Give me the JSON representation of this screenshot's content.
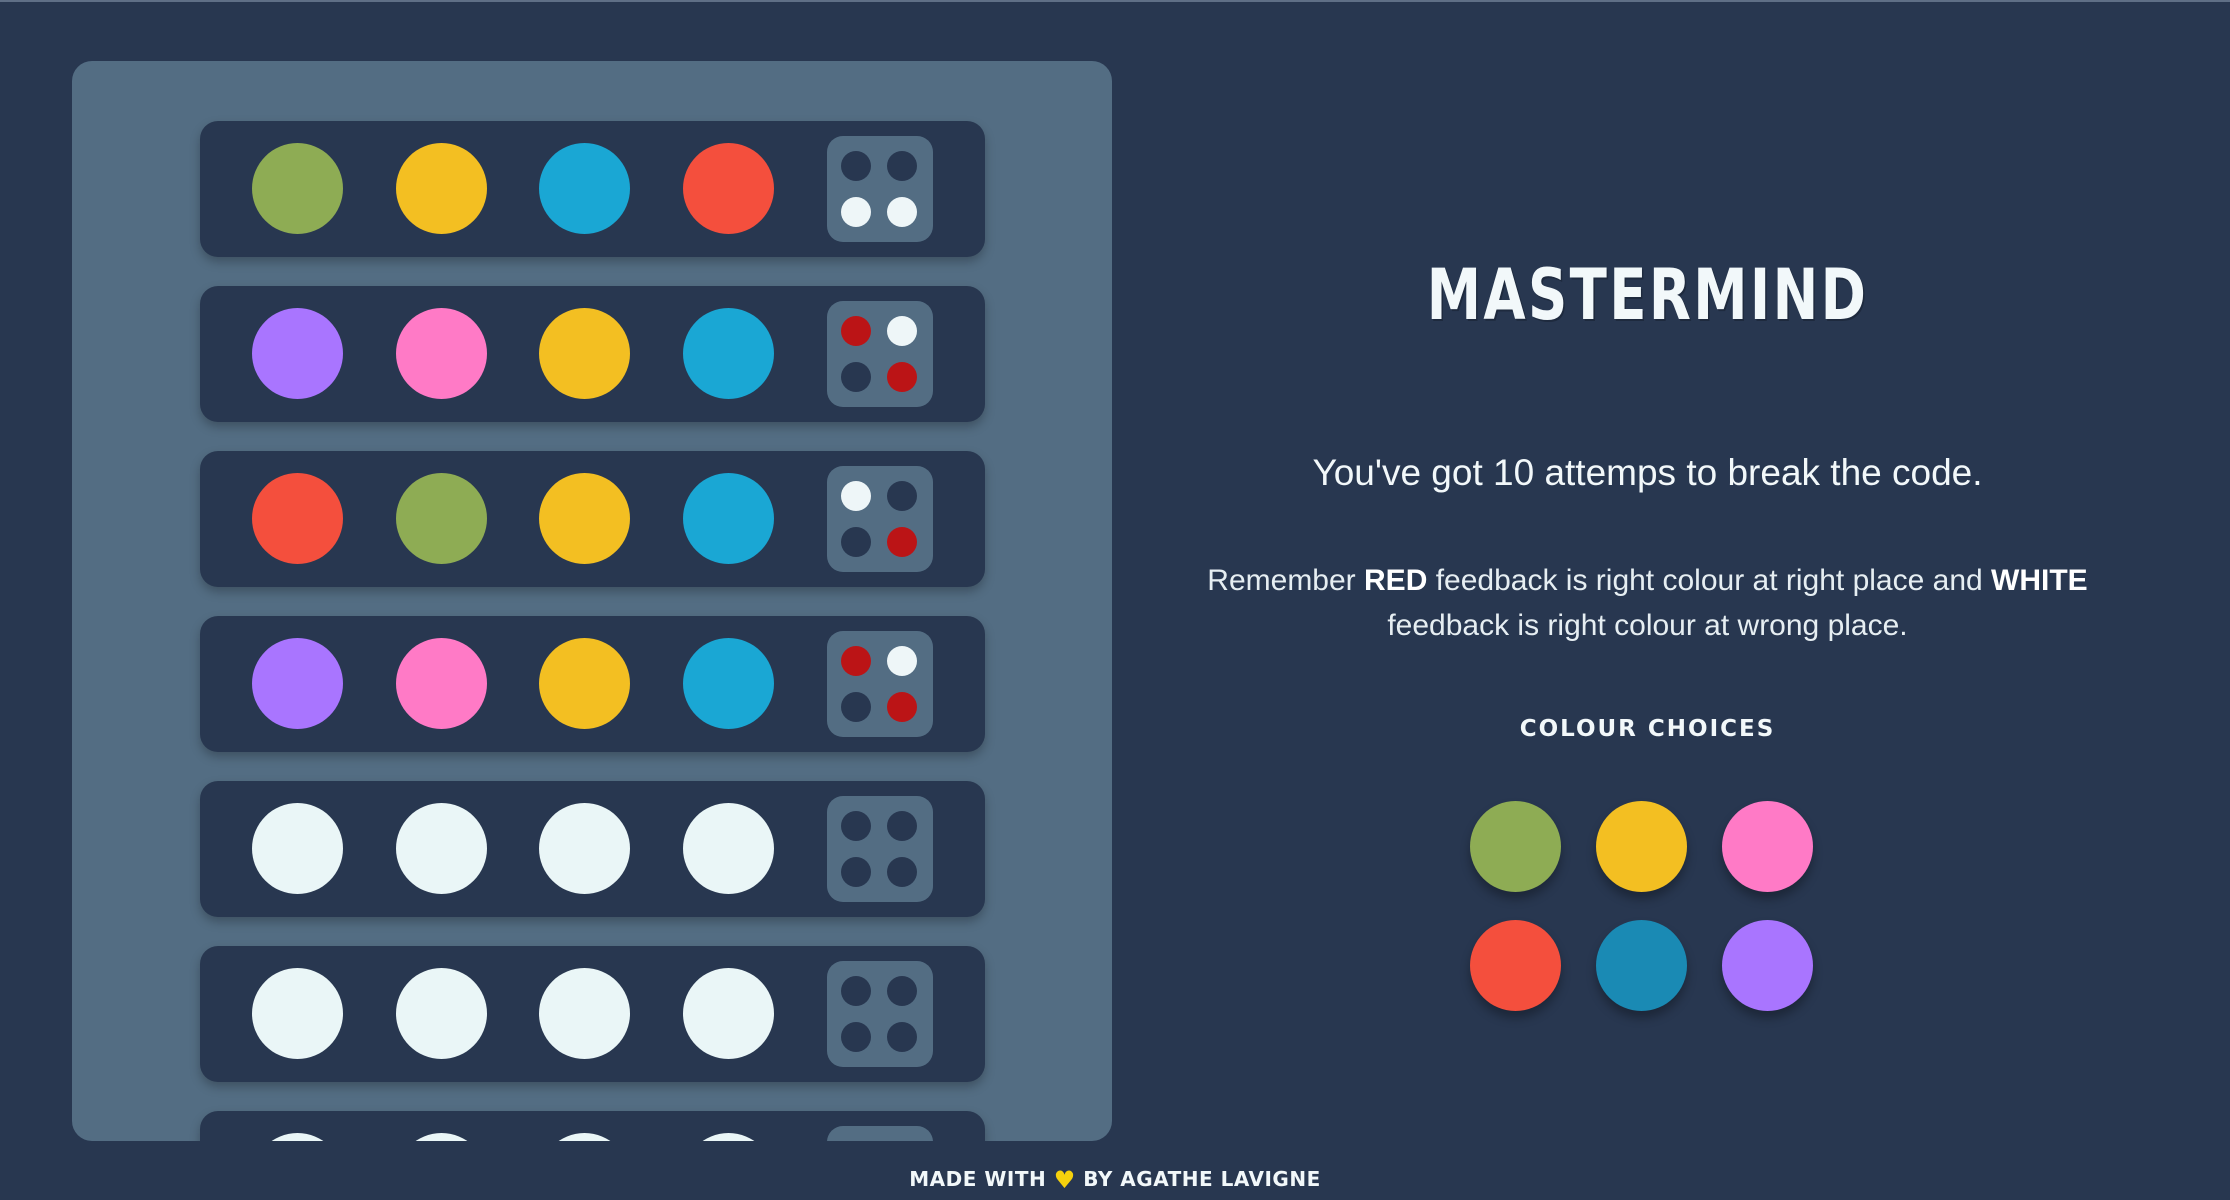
{
  "colors": {
    "green": "#8eac54",
    "yellow": "#f3bf22",
    "blue": "#1aa7d4",
    "red": "#f44f3d",
    "purple": "#a975ff",
    "pink": "#ff7ac6",
    "empty": "#eaf6f7",
    "choice_blue": "#1a8ab4",
    "fb_empty": "#283750",
    "fb_red": "#bb1416",
    "fb_white": "#eef6f8"
  },
  "board": {
    "rows": [
      {
        "pegs": [
          "green",
          "yellow",
          "blue",
          "red"
        ],
        "feedback": [
          "empty",
          "empty",
          "white",
          "white"
        ]
      },
      {
        "pegs": [
          "purple",
          "pink",
          "yellow",
          "blue"
        ],
        "feedback": [
          "red",
          "white",
          "empty",
          "red"
        ]
      },
      {
        "pegs": [
          "red",
          "green",
          "yellow",
          "blue"
        ],
        "feedback": [
          "white",
          "empty",
          "empty",
          "red"
        ]
      },
      {
        "pegs": [
          "purple",
          "pink",
          "yellow",
          "blue"
        ],
        "feedback": [
          "red",
          "white",
          "empty",
          "red"
        ]
      },
      {
        "pegs": [
          "empty",
          "empty",
          "empty",
          "empty"
        ],
        "feedback": [
          "empty",
          "empty",
          "empty",
          "empty"
        ]
      },
      {
        "pegs": [
          "empty",
          "empty",
          "empty",
          "empty"
        ],
        "feedback": [
          "empty",
          "empty",
          "empty",
          "empty"
        ]
      },
      {
        "pegs": [
          "empty",
          "empty",
          "empty",
          "empty"
        ],
        "feedback": [
          "empty",
          "empty",
          "empty",
          "empty"
        ]
      }
    ]
  },
  "info": {
    "title": "MASTERMIND",
    "attempts_text": "You've got 10 attemps to break the code.",
    "rules_prefix": "Remember ",
    "rules_red": "RED",
    "rules_mid": " feedback is right colour at right place and ",
    "rules_white": "WHITE",
    "rules_suffix": " feedback is right colour at wrong place.",
    "choices_heading": "COLOUR CHOICES",
    "choices": [
      "green",
      "yellow",
      "pink",
      "red",
      "choice_blue",
      "purple"
    ]
  },
  "footer": {
    "prefix": "MADE WITH",
    "heart_icon": "heart-icon",
    "suffix": "BY AGATHE LAVIGNE"
  }
}
